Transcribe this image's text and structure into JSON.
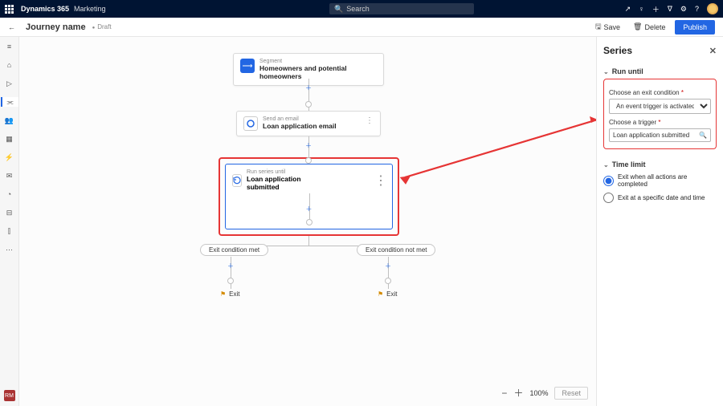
{
  "app": {
    "brand": "Dynamics 365",
    "module": "Marketing",
    "search_placeholder": "Search"
  },
  "top_icons": {
    "share": "↗",
    "bulb": "♀",
    "plus": "＋",
    "filter": "∇",
    "gear": "⚙",
    "help": "?"
  },
  "cmd": {
    "title": "Journey name",
    "status": "Draft",
    "save": "Save",
    "delete": "Delete",
    "publish": "Publish"
  },
  "leftrail": {
    "avatar_initials": "RM"
  },
  "nodes": {
    "segment": {
      "label": "Segment",
      "value": "Homeowners and potential homeowners"
    },
    "email": {
      "label": "Send an email",
      "value": "Loan application email"
    },
    "series": {
      "label": "Run series until",
      "value": "Loan application submitted"
    }
  },
  "branches": {
    "met": "Exit condition met",
    "notmet": "Exit condition not met",
    "exit": "Exit"
  },
  "zoom": {
    "pct": "100%",
    "reset": "Reset"
  },
  "panel": {
    "title": "Series",
    "section_run": "Run until",
    "exit_cond_label": "Choose an exit condition",
    "exit_cond_value": "An event trigger is activated",
    "trigger_label": "Choose a trigger",
    "trigger_value": "Loan application submitted",
    "section_time": "Time limit",
    "radio1": "Exit when all actions are completed",
    "radio2": "Exit at a specific date and time"
  }
}
